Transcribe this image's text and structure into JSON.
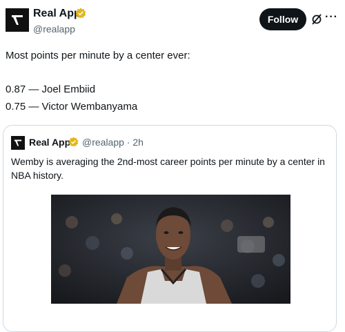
{
  "tweet": {
    "author_name": "Real App",
    "author_handle": "@realapp",
    "follow_label": "Follow",
    "more_label": "···",
    "text_lines": [
      "Most points per minute by a center ever:",
      "0.87 — Joel Embiid",
      "0.75 — Victor Wembanyama"
    ]
  },
  "quote": {
    "author_name": "Real App",
    "handle_time": "@realapp · 2h",
    "text": "Wemby is averaging the 2nd-most career points per minute by a center in NBA history."
  },
  "colors": {
    "badge": "#e2b719",
    "text_primary": "#0f1419",
    "text_secondary": "#536471",
    "border": "#cfd9de",
    "jersey": "#d9d9d9"
  },
  "icons": {
    "avatar": "logo-icon",
    "badge": "verified-badge-icon",
    "grok": "grok-icon",
    "more": "more-icon"
  }
}
